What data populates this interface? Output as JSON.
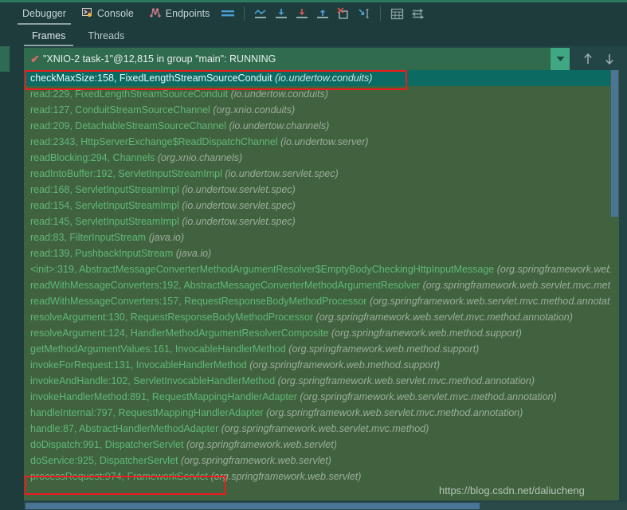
{
  "toolbar": {
    "tabs": [
      {
        "label": "Debugger",
        "icon": "debugger-icon",
        "active": true
      },
      {
        "label": "Console",
        "icon": "console-icon",
        "active": false
      },
      {
        "label": "Endpoints",
        "icon": "endpoints-icon",
        "active": false
      }
    ],
    "icons": [
      {
        "name": "layout-lines-icon",
        "title": "Layout"
      },
      {
        "name": "step-out-of-icon",
        "title": "Show Execution Point"
      },
      {
        "name": "step-over-icon",
        "title": "Step Over"
      },
      {
        "name": "step-into-icon",
        "title": "Step Into"
      },
      {
        "name": "step-out-icon",
        "title": "Step Out"
      },
      {
        "name": "drop-frame-icon",
        "title": "Drop Frame"
      },
      {
        "name": "run-to-cursor-icon",
        "title": "Run to Cursor"
      },
      {
        "name": "evaluate-expression-icon",
        "title": "Evaluate Expression"
      },
      {
        "name": "settings-lines-icon",
        "title": "Settings"
      }
    ]
  },
  "subtabs": [
    {
      "label": "Frames",
      "active": true
    },
    {
      "label": "Threads",
      "active": false
    }
  ],
  "thread_selector": {
    "status_glyph": "✔",
    "label": "\"XNIO-2 task-1\"@12,815 in group \"main\": RUNNING",
    "dropdown_glyph": "▼",
    "nav_up_glyph": "↑",
    "nav_down_glyph": "↓",
    "filter_glyph": "filter-funnel-icon"
  },
  "colors": {
    "panel_bg": "#41623f",
    "selected_bg": "#0b6b62",
    "frame_text": "#5fb878",
    "package_text": "#9aae9a",
    "annotation": "#ee1c1c",
    "scrollbar": "#4a7597",
    "combo_bg": "#2f6b4c",
    "accent": "#3fa882"
  },
  "frames": [
    {
      "method": "checkMaxSize:158, FixedLengthStreamSourceConduit",
      "pkg": "(io.undertow.conduits)",
      "selected": true
    },
    {
      "method": "read:229, FixedLengthStreamSourceConduit",
      "pkg": "(io.undertow.conduits)",
      "selected": false
    },
    {
      "method": "read:127, ConduitStreamSourceChannel",
      "pkg": "(org.xnio.conduits)",
      "selected": false
    },
    {
      "method": "read:209, DetachableStreamSourceChannel",
      "pkg": "(io.undertow.channels)",
      "selected": false
    },
    {
      "method": "read:2343, HttpServerExchange$ReadDispatchChannel",
      "pkg": "(io.undertow.server)",
      "selected": false
    },
    {
      "method": "readBlocking:294, Channels",
      "pkg": "(org.xnio.channels)",
      "selected": false
    },
    {
      "method": "readIntoBuffer:192, ServletInputStreamImpl",
      "pkg": "(io.undertow.servlet.spec)",
      "selected": false
    },
    {
      "method": "read:168, ServletInputStreamImpl",
      "pkg": "(io.undertow.servlet.spec)",
      "selected": false
    },
    {
      "method": "read:154, ServletInputStreamImpl",
      "pkg": "(io.undertow.servlet.spec)",
      "selected": false
    },
    {
      "method": "read:145, ServletInputStreamImpl",
      "pkg": "(io.undertow.servlet.spec)",
      "selected": false
    },
    {
      "method": "read:83, FilterInputStream",
      "pkg": "(java.io)",
      "selected": false
    },
    {
      "method": "read:139, PushbackInputStream",
      "pkg": "(java.io)",
      "selected": false
    },
    {
      "method": "<init>:319, AbstractMessageConverterMethodArgumentResolver$EmptyBodyCheckingHttpInputMessage",
      "pkg": "(org.springframework.web.servlet.mvc.method.annotation)",
      "selected": false
    },
    {
      "method": "readWithMessageConverters:192, AbstractMessageConverterMethodArgumentResolver",
      "pkg": "(org.springframework.web.servlet.mvc.method.annotation)",
      "selected": false
    },
    {
      "method": "readWithMessageConverters:157, RequestResponseBodyMethodProcessor",
      "pkg": "(org.springframework.web.servlet.mvc.method.annotation)",
      "selected": false
    },
    {
      "method": "resolveArgument:130, RequestResponseBodyMethodProcessor",
      "pkg": "(org.springframework.web.servlet.mvc.method.annotation)",
      "selected": false
    },
    {
      "method": "resolveArgument:124, HandlerMethodArgumentResolverComposite",
      "pkg": "(org.springframework.web.method.support)",
      "selected": false
    },
    {
      "method": "getMethodArgumentValues:161, InvocableHandlerMethod",
      "pkg": "(org.springframework.web.method.support)",
      "selected": false
    },
    {
      "method": "invokeForRequest:131, InvocableHandlerMethod",
      "pkg": "(org.springframework.web.method.support)",
      "selected": false
    },
    {
      "method": "invokeAndHandle:102, ServletInvocableHandlerMethod",
      "pkg": "(org.springframework.web.servlet.mvc.method.annotation)",
      "selected": false
    },
    {
      "method": "invokeHandlerMethod:891, RequestMappingHandlerAdapter",
      "pkg": "(org.springframework.web.servlet.mvc.method.annotation)",
      "selected": false
    },
    {
      "method": "handleInternal:797, RequestMappingHandlerAdapter",
      "pkg": "(org.springframework.web.servlet.mvc.method.annotation)",
      "selected": false
    },
    {
      "method": "handle:87, AbstractHandlerMethodAdapter",
      "pkg": "(org.springframework.web.servlet.mvc.method)",
      "selected": false
    },
    {
      "method": "doDispatch:991, DispatcherServlet",
      "pkg": "(org.springframework.web.servlet)",
      "selected": false
    },
    {
      "method": "doService:925, DispatcherServlet",
      "pkg": "(org.springframework.web.servlet)",
      "selected": false
    },
    {
      "method": "processRequest:974, FrameworkServlet",
      "pkg": "(org.springframework.web.servlet)",
      "selected": false
    }
  ],
  "watermark": "https://blog.csdn.net/daliucheng"
}
